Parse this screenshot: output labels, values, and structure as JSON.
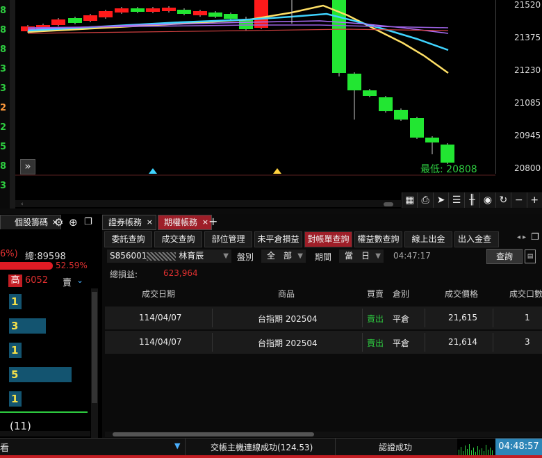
{
  "chart": {
    "left_numbers": [
      "8",
      "8",
      "8",
      "3",
      "3",
      "2",
      "2",
      "5",
      "8",
      "3"
    ],
    "price_labels": [
      "21520",
      "21375",
      "21230",
      "21085",
      "20945",
      "20800"
    ],
    "low_label": "最低: 20808",
    "expand_icon": "double-chevron-right-icon",
    "colors": {
      "up": "#ff1a1a",
      "down": "#22e632",
      "ma_yellow": "#ffe066",
      "ma_cyan": "#3fd4ff",
      "ma_purple": "#b070ff",
      "ma_red": "#d04040"
    }
  },
  "chart_toolbar": {
    "icons": [
      "table-icon",
      "print-icon",
      "cursor-icon",
      "list-icon",
      "candlestick-icon",
      "eye-icon",
      "refresh-icon",
      "minus-icon",
      "plus-icon"
    ]
  },
  "left_panel": {
    "tab_label": "個股籌碼",
    "tab_close": "×",
    "pct_top": "6%)",
    "total_label": "總:89598",
    "pct_bar": "52.59%",
    "high_label": "高",
    "high_value": "6052",
    "sell_label": "賣",
    "quote_values": [
      1,
      3,
      1,
      5,
      1
    ],
    "count": "(11)"
  },
  "tabs": [
    {
      "label": "證券帳務",
      "active": false,
      "close": "×"
    },
    {
      "label": "期權帳務",
      "active": true,
      "close": "×"
    }
  ],
  "tab_add": "+",
  "subtabs": [
    "委託查詢",
    "成交查詢",
    "部位管理",
    "未平倉損益",
    "對帳單查詢",
    "權益數查詢",
    "線上出金",
    "出入金查"
  ],
  "subtab_active": 4,
  "filters": {
    "account_prefix": "S856001",
    "account_name": "林育辰",
    "market_label": "盤別",
    "market_value": "全　部",
    "period_label": "期間",
    "period_value": "當　日",
    "time": "04:47:17",
    "query_button": "查詢"
  },
  "summary": {
    "label": "總損益:",
    "value": "623,964"
  },
  "table": {
    "headers": [
      "成交日期",
      "商品",
      "買賣",
      "倉別",
      "成交價格",
      "成交口數"
    ],
    "rows": [
      {
        "date": "114/04/07",
        "product": "台指期 202504",
        "side": "賣出",
        "position": "平倉",
        "price": "21,615",
        "qty": "1"
      },
      {
        "date": "114/04/07",
        "product": "台指期 202504",
        "side": "賣出",
        "position": "平倉",
        "price": "21,614",
        "qty": "3"
      }
    ]
  },
  "status": {
    "left_text": "看",
    "connection": "交帳主機連線成功(124.53)",
    "auth": "認證成功",
    "time": "04:48:57"
  }
}
